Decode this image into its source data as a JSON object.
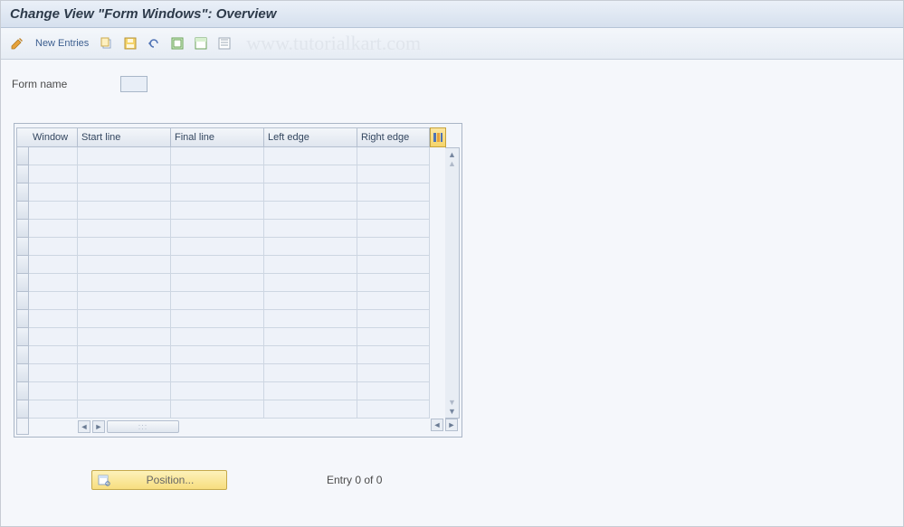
{
  "title": "Change View \"Form Windows\": Overview",
  "toolbar": {
    "new_entries": "New Entries"
  },
  "watermark": "www.tutorialkart.com",
  "form": {
    "name_label": "Form name",
    "name_value": ""
  },
  "grid": {
    "columns": [
      "Window",
      "Start line",
      "Final line",
      "Left edge",
      "Right edge"
    ],
    "row_count": 15
  },
  "footer": {
    "position_label": "Position...",
    "entry_status": "Entry 0 of 0"
  }
}
